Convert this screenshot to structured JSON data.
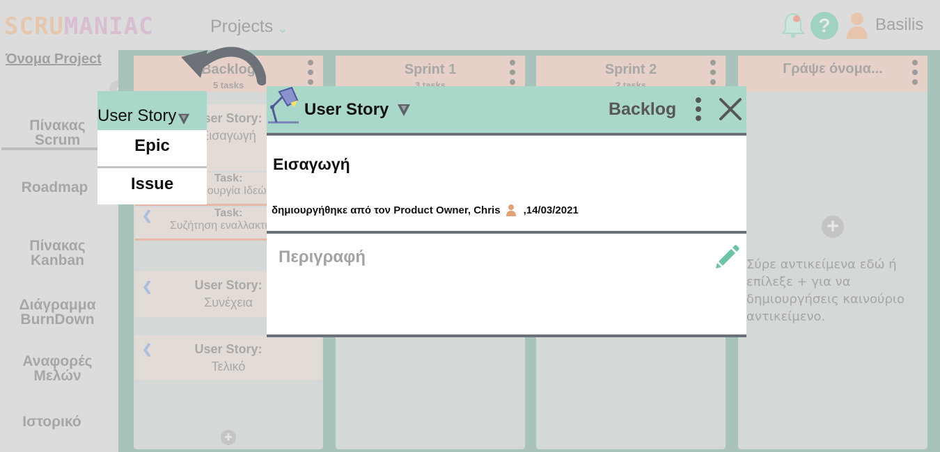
{
  "app": {
    "logo": {
      "part1": "SCRU",
      "part2": "MANIAC"
    },
    "projects_label": "Projects",
    "username": "Basilis",
    "help_glyph": "?"
  },
  "sidebar": {
    "project_name": "Όνομα Project",
    "collapse_glyph": "‹",
    "items": [
      {
        "line1": "Πίνακας",
        "line2": "Scrum"
      },
      {
        "line1": "Roadmap",
        "line2": ""
      },
      {
        "line1": "Πίνακας",
        "line2": "Kanban"
      },
      {
        "line1": "Διάγραμμα",
        "line2": "BurnDown"
      },
      {
        "line1": "Αναφορές",
        "line2": "Μελών"
      },
      {
        "line1": "Ιστορικό",
        "line2": ""
      }
    ]
  },
  "board": {
    "columns": [
      {
        "title": "Backlog",
        "subtitle": "5 tasks"
      },
      {
        "title": "Sprint 1",
        "subtitle": "3 tasks"
      },
      {
        "title": "Sprint 2",
        "subtitle": "2 tasks"
      },
      {
        "title": "Γράψε όνομα...",
        "subtitle": ""
      }
    ],
    "backlog_cards": [
      {
        "type": "User Story:",
        "name": "Εισαγωγή"
      },
      {
        "type": "User Story:",
        "name": "Συνέχεια"
      },
      {
        "type": "User Story:",
        "name": "Τελικό"
      }
    ],
    "backlog_tasks": [
      {
        "type": "Task:",
        "name": "Δημιουργία Ιδεών"
      },
      {
        "type": "Task:",
        "name": "Συζήτηση εναλλακτικών"
      }
    ],
    "plus_glyph": "+",
    "drop_hint": "Σύρε αντικείμενα εδώ ή επίλεξε + για να δημιουργήσεις καινούριο αντικείμενο."
  },
  "type_dropdown": {
    "selected": "User Story",
    "options": [
      "Epic",
      "Issue"
    ]
  },
  "modal": {
    "type": "User Story",
    "sprint": "Backlog",
    "title": "Εισαγωγή",
    "meta_prefix": "δημιουργήθηκε από τον Product Owner, Chris",
    "meta_date": ",14/03/2021",
    "description_label": "Περιγραφή"
  },
  "colors": {
    "accent": "#a9d7c9",
    "header_peach": "#e6d0c7",
    "rule": "#6b6f78",
    "edit_green": "#6cc4a4"
  }
}
